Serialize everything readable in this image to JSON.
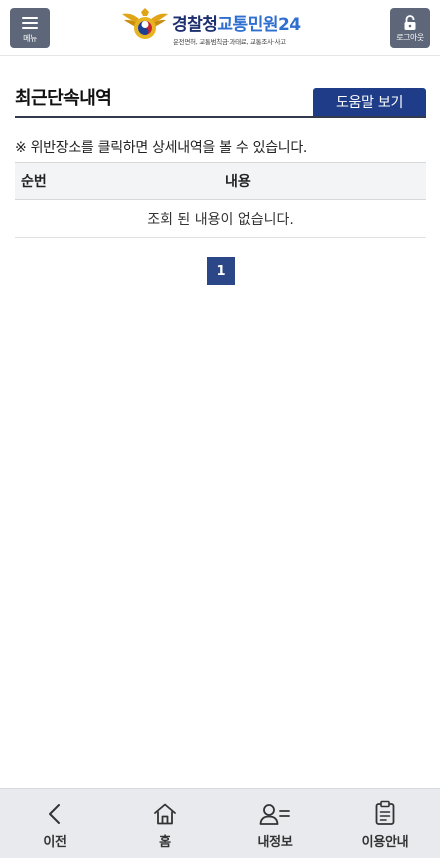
{
  "header": {
    "menu_label": "메뉴",
    "logout_label": "로그아웃",
    "logo_title_part1": "경찰청",
    "logo_title_part2": "교통민원24",
    "logo_subtitle": "운전면허, 교통범칙금·과태료, 교통조사·사고",
    "colors": {
      "header_button": "#5d6779",
      "logo_navy": "#1d2f6f",
      "logo_blue": "#2f6fd0"
    }
  },
  "main": {
    "section_title": "최근단속내역",
    "help_button_label": "도움말 보기",
    "notice": "※ 위반장소를 클릭하면 상세내역을 볼 수 있습니다.",
    "table": {
      "headers": [
        "순번",
        "내용"
      ],
      "empty_message": "조회 된 내용이 없습니다."
    },
    "pagination": {
      "current_page": "1"
    },
    "colors": {
      "accent": "#1e3c87"
    }
  },
  "bottom_nav": {
    "items": [
      {
        "label": "이전",
        "icon": "chevron-left-icon"
      },
      {
        "label": "홈",
        "icon": "home-icon"
      },
      {
        "label": "내정보",
        "icon": "user-list-icon"
      },
      {
        "label": "이용안내",
        "icon": "clipboard-icon"
      }
    ]
  }
}
